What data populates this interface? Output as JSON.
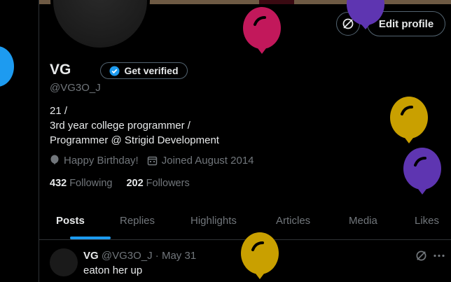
{
  "profile": {
    "name": "VG",
    "handle": "@VG3O_J",
    "bio_lines": [
      "21 /",
      "3rd year college programmer /",
      "Programmer @ Strigid Development"
    ],
    "birthday": "Happy Birthday!",
    "joined": "Joined August 2014",
    "following_count": "432",
    "following_label": "Following",
    "followers_count": "202",
    "followers_label": "Followers"
  },
  "buttons": {
    "get_verified": "Get verified",
    "edit_profile": "Edit profile"
  },
  "tabs": [
    {
      "label": "Posts"
    },
    {
      "label": "Replies"
    },
    {
      "label": "Highlights"
    },
    {
      "label": "Articles"
    },
    {
      "label": "Media"
    },
    {
      "label": "Likes"
    }
  ],
  "post": {
    "name": "VG",
    "handle": "@VG3O_J",
    "separator": "·",
    "date": "May 31",
    "text": "eaton her up"
  },
  "colors": {
    "accent": "#1d9bf0",
    "balloon_pink": "#c2185b",
    "balloon_gold": "#c9a000",
    "balloon_purple": "#5e35b1"
  }
}
